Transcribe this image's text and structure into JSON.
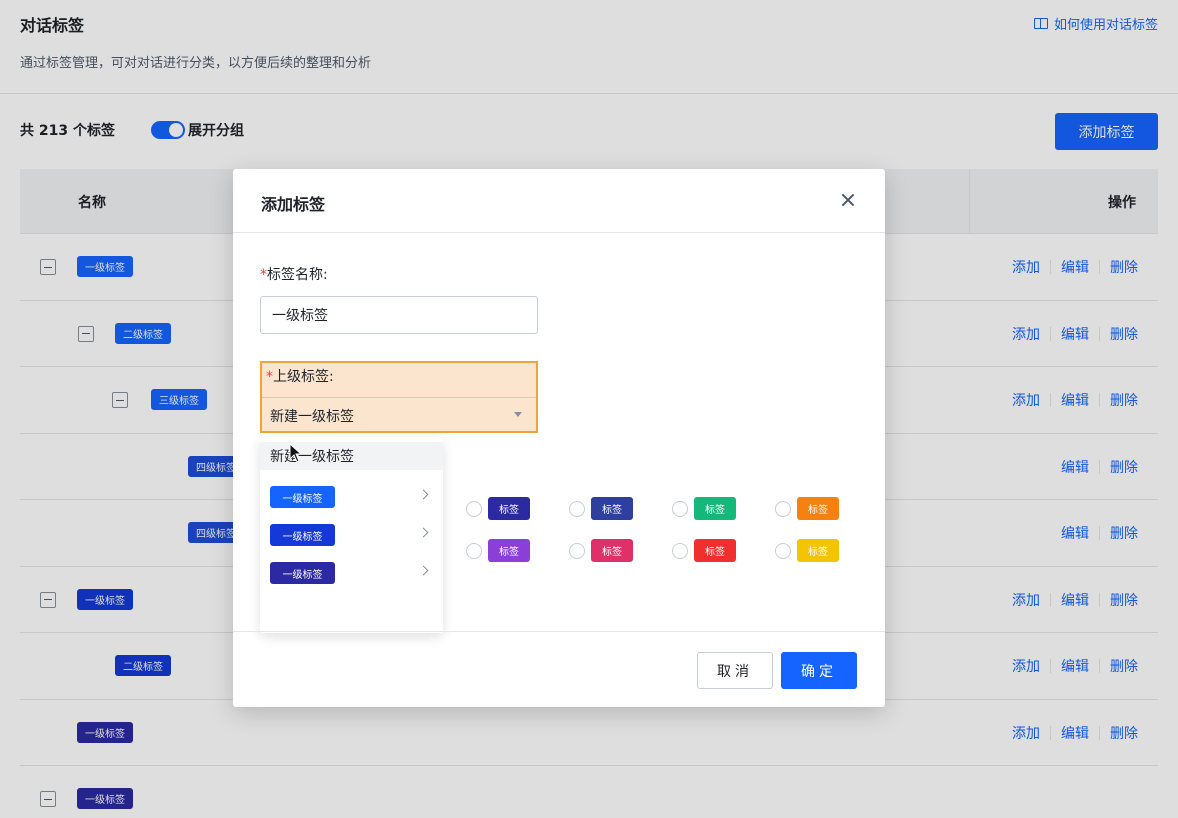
{
  "page": {
    "title": "对话标签",
    "description": "通过标签管理，可对对话进行分类，以方便后续的整理和分析",
    "help_link": "如何使用对话标签",
    "count_text": "共 213 个标签",
    "toggle_label": "展开分组",
    "add_button": "添加标签"
  },
  "table": {
    "col_name": "名称",
    "col_ops": "操作",
    "op_add": "添加",
    "op_edit": "编辑",
    "op_delete": "删除",
    "rows": [
      {
        "tag": "一级标签",
        "color": "#1664ff",
        "collapse": true,
        "indent": 0,
        "ops": [
          "添加",
          "编辑",
          "删除"
        ]
      },
      {
        "tag": "二级标签",
        "color": "#1664ff",
        "collapse": true,
        "indent": 1,
        "ops": [
          "添加",
          "编辑",
          "删除"
        ]
      },
      {
        "tag": "三级标签",
        "color": "#1664ff",
        "collapse": true,
        "indent": 2,
        "ops": [
          "添加",
          "编辑",
          "删除"
        ]
      },
      {
        "tag": "四级标签",
        "color": "#1d4ed8",
        "collapse": false,
        "indent": 3,
        "ops": [
          "编辑",
          "删除"
        ]
      },
      {
        "tag": "四级标签",
        "color": "#1d4ed8",
        "collapse": false,
        "indent": 3,
        "ops": [
          "编辑",
          "删除"
        ]
      },
      {
        "tag": "一级标签",
        "color": "#1539d6",
        "collapse": true,
        "indent": 0,
        "ops": [
          "添加",
          "编辑",
          "删除"
        ]
      },
      {
        "tag": "二级标签",
        "color": "#1539d6",
        "collapse": false,
        "indent": 1,
        "ops": [
          "添加",
          "编辑",
          "删除"
        ]
      },
      {
        "tag": "一级标签",
        "color": "#2b2aa3",
        "collapse": false,
        "indent": 0,
        "ops": [
          "添加",
          "编辑",
          "删除"
        ]
      },
      {
        "tag": "一级标签",
        "color": "#2b2aa3",
        "collapse": true,
        "indent": 0,
        "ops": []
      }
    ]
  },
  "modal": {
    "title": "添加标签",
    "name_label": "标签名称:",
    "name_value": "一级标签",
    "parent_label": "上级标签:",
    "parent_value": "新建一级标签",
    "dropdown_first": "新建一级标签",
    "dropdown_items": [
      {
        "label": "一级标签",
        "color": "#1664ff"
      },
      {
        "label": "一级标签",
        "color": "#1539d6"
      },
      {
        "label": "一级标签",
        "color": "#2b2aa3"
      }
    ],
    "colors": [
      {
        "label": "标签",
        "color": "#2b2aa3"
      },
      {
        "label": "标签",
        "color": "#2f3f9e"
      },
      {
        "label": "标签",
        "color": "#14b87a"
      },
      {
        "label": "标签",
        "color": "#f7810f"
      },
      {
        "label": "标签",
        "color": "#8b3fd9"
      },
      {
        "label": "标签",
        "color": "#e0306a"
      },
      {
        "label": "标签",
        "color": "#f0302e"
      },
      {
        "label": "标签",
        "color": "#f5c400"
      }
    ],
    "cancel": "取消",
    "ok": "确定"
  },
  "colors": {
    "primary": "#1664ff",
    "highlight_bg": "#fbe5cf",
    "highlight_border": "#f0a43c"
  }
}
